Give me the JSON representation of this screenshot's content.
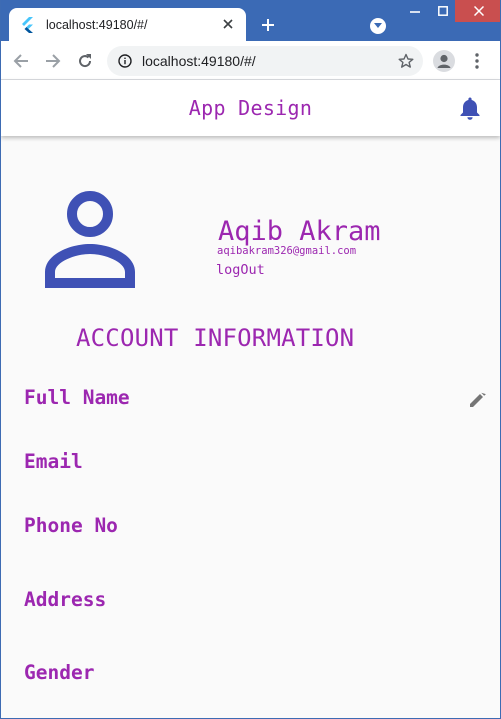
{
  "browser": {
    "tab_title": "localhost:49180/#/",
    "url": "localhost:49180/#/",
    "chrome_color": "#3b6ab5"
  },
  "app": {
    "title": "App Design",
    "accent_color": "#9c27b0",
    "icon_color": "#3f51b5"
  },
  "profile": {
    "name": "Aqib Akram",
    "email": "aqibakram326@gmail.com",
    "logout_label": "logOut"
  },
  "account": {
    "section_title": "ACCOUNT INFORMATION",
    "fields": [
      {
        "label": "Full Name"
      },
      {
        "label": "Email"
      },
      {
        "label": "Phone No"
      },
      {
        "label": "Address"
      },
      {
        "label": "Gender"
      }
    ]
  },
  "icons": {
    "favicon": "flutter-icon",
    "tab_close": "close-icon",
    "new_tab": "plus-icon",
    "tab_search": "chevron-down-icon",
    "back": "arrow-back-icon",
    "forward": "arrow-forward-icon",
    "reload": "reload-icon",
    "site_info": "info-icon",
    "bookmark": "star-icon",
    "profile": "account-circle-icon",
    "menu": "more-vert-icon",
    "notifications": "bell-icon",
    "avatar": "person-outline-icon",
    "edit": "pencil-icon"
  }
}
